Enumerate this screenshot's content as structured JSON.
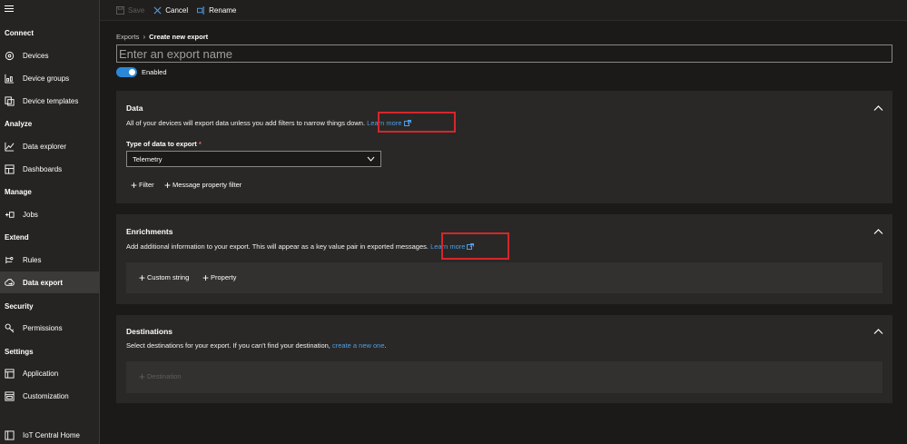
{
  "sidebar": {
    "sections": [
      {
        "label": "Connect"
      },
      {
        "label": "Analyze"
      },
      {
        "label": "Manage"
      },
      {
        "label": "Extend"
      },
      {
        "label": "Security"
      },
      {
        "label": "Settings"
      }
    ],
    "items": [
      {
        "label": "Devices",
        "icon": "devices-icon"
      },
      {
        "label": "Device groups",
        "icon": "device-groups-icon"
      },
      {
        "label": "Device templates",
        "icon": "device-templates-icon"
      },
      {
        "label": "Data explorer",
        "icon": "data-explorer-icon"
      },
      {
        "label": "Dashboards",
        "icon": "dashboards-icon"
      },
      {
        "label": "Jobs",
        "icon": "jobs-icon"
      },
      {
        "label": "Rules",
        "icon": "rules-icon"
      },
      {
        "label": "Data export",
        "icon": "data-export-icon",
        "active": true
      },
      {
        "label": "Permissions",
        "icon": "permissions-icon"
      },
      {
        "label": "Application",
        "icon": "application-icon"
      },
      {
        "label": "Customization",
        "icon": "customization-icon"
      },
      {
        "label": "IoT Central Home",
        "icon": "iot-central-home-icon"
      }
    ]
  },
  "toolbar": {
    "save_label": "Save",
    "cancel_label": "Cancel",
    "rename_label": "Rename"
  },
  "breadcrumb": {
    "parent": "Exports",
    "current": "Create new export"
  },
  "export_name": {
    "value": "",
    "placeholder": "Enter an export name"
  },
  "enabled_toggle": {
    "label": "Enabled",
    "on": true
  },
  "data_card": {
    "title": "Data",
    "description": "All of your devices will export data unless you add filters to narrow things down.",
    "learn_more": "Learn more",
    "type_label": "Type of data to export",
    "required_mark": "*",
    "type_value": "Telemetry",
    "filter_label": "Filter",
    "message_filter_label": "Message property filter"
  },
  "enrichments_card": {
    "title": "Enrichments",
    "description": "Add additional information to your export. This will appear as a key value pair in exported messages.",
    "learn_more": "Learn more",
    "custom_string_label": "Custom string",
    "property_label": "Property"
  },
  "destinations_card": {
    "title": "Destinations",
    "description": "Select destinations for your export. If you can't find your destination,",
    "create_link": "create a new one",
    "period": ".",
    "destination_label": "Destination"
  },
  "colors": {
    "accent": "#2b88d8",
    "link": "#4f9fe6",
    "highlight": "#d6262a",
    "background": "#1b1a19",
    "card": "#292827"
  }
}
